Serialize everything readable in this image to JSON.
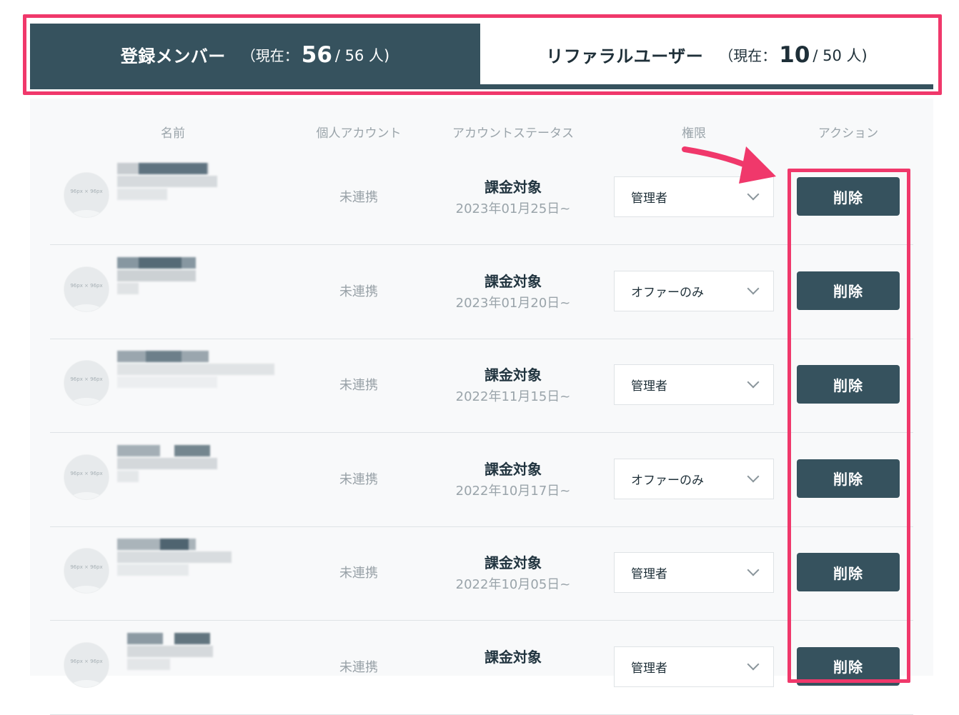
{
  "tabs": [
    {
      "title": "登録メンバー",
      "prefix": "（現在：",
      "current": "56",
      "suffix": "/ 56 人)"
    },
    {
      "title": "リファラルユーザー",
      "prefix": "（現在：",
      "current": "10",
      "suffix": "/ 50 人)"
    }
  ],
  "table": {
    "headers": [
      "名前",
      "個人アカウント",
      "アカウントステータス",
      "権限",
      "アクション"
    ],
    "rows": [
      {
        "avatar": "96px × 96px",
        "personal": "未連携",
        "status": "課金対象",
        "date": "2023年01月25日~",
        "role": "管理者",
        "action": "削除"
      },
      {
        "avatar": "96px × 96px",
        "personal": "未連携",
        "status": "課金対象",
        "date": "2023年01月20日~",
        "role": "オファーのみ",
        "action": "削除"
      },
      {
        "avatar": "96px × 96px",
        "personal": "未連携",
        "status": "課金対象",
        "date": "2022年11月15日~",
        "role": "管理者",
        "action": "削除"
      },
      {
        "avatar": "96px × 96px",
        "personal": "未連携",
        "status": "課金対象",
        "date": "2022年10月17日~",
        "role": "オファーのみ",
        "action": "削除"
      },
      {
        "avatar": "96px × 96px",
        "personal": "未連携",
        "status": "課金対象",
        "date": "2022年10月05日~",
        "role": "管理者",
        "action": "削除"
      },
      {
        "avatar": "96px × 96px",
        "personal": "未連携",
        "status": "課金対象",
        "date": "",
        "role": "管理者",
        "action": "削除"
      }
    ]
  },
  "colors": {
    "accent": "#36525e",
    "highlight": "#f0386b"
  }
}
